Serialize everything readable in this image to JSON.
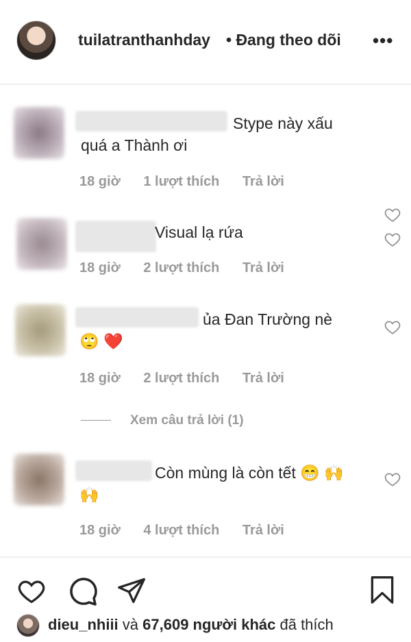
{
  "header": {
    "username": "tuilatranthanhday",
    "follow_status": "• Đang theo dõi",
    "more": "•••"
  },
  "comments": [
    {
      "text": "Stype này xấu quá a Thành ơi",
      "time": "18 giờ",
      "likes": "1 lượt thích",
      "reply": "Trả lời"
    },
    {
      "text": "Visual lạ rứa",
      "time": "18 giờ",
      "likes": "2 lượt thích",
      "reply": "Trả lời"
    },
    {
      "text": "ủa Đan Trường nè",
      "emoji": "🙄 ❤️",
      "time": "18 giờ",
      "likes": "2 lượt thích",
      "reply": "Trả lời",
      "view_replies": "Xem câu trả lời (1)"
    },
    {
      "text": "Còn mùng là còn tết 😁 🙌",
      "emoji": "🙌",
      "time": "18 giờ",
      "likes": "4 lượt thích",
      "reply": "Trả lời"
    }
  ],
  "likes_summary": {
    "user": "dieu_nhiii",
    "connector": " và ",
    "others": "67,609 người khác",
    "suffix": " đã thích"
  },
  "icons": {
    "like": "heart-icon",
    "comment": "comment-icon",
    "share": "send-icon",
    "save": "bookmark-icon"
  }
}
